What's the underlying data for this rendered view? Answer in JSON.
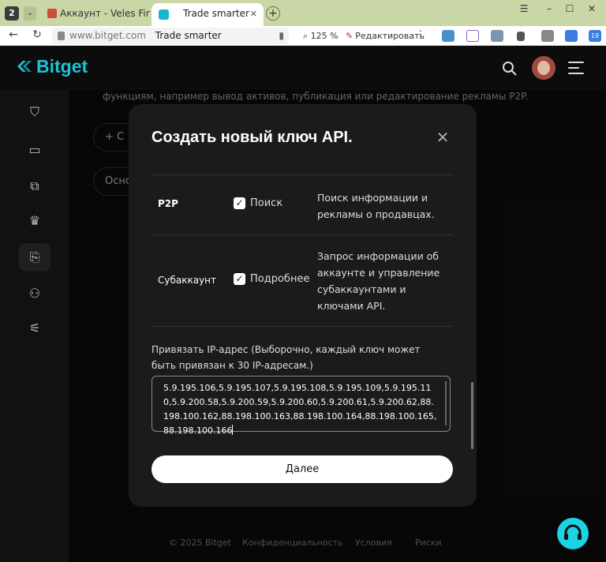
{
  "browser": {
    "tab_count": "2",
    "tabs": [
      {
        "label": "Аккаунт - Veles Finance"
      },
      {
        "label": "Trade smarter"
      }
    ],
    "url_host": "www.bitget.com",
    "url_title": "Trade smarter",
    "zoom": "125 %",
    "edit_label": "Редактировать",
    "ext_badge": "19"
  },
  "header": {
    "logo": "Bitget"
  },
  "background": {
    "notice": "функциям, например вывод активов, публикация или редактирование рекламы P2P.",
    "btn1": "+ С",
    "btn2": "Осно"
  },
  "modal": {
    "title": "Создать новый ключ API.",
    "permissions": [
      {
        "category": "P2P",
        "checkbox": "Поиск",
        "description": "Поиск информации и рекламы о продавцах."
      },
      {
        "category": "Субаккаунт",
        "checkbox": "Подробнее",
        "description": "Запрос информации об аккаунте и управление субаккаунтами и ключами API."
      }
    ],
    "ip_label": "Привязать IP-адрес (Выборочно, каждый ключ может быть привязан к 30 IP-адресам.)",
    "ip_value": "5.9.195.106,5.9.195.107,5.9.195.108,5.9.195.109,5.9.195.110,5.9.200.58,5.9.200.59,5.9.200.60,5.9.200.61,5.9.200.62,88.198.100.162,88.198.100.163,88.198.100.164,88.198.100.165,88.198.100.166",
    "next_label": "Далее"
  },
  "footer": {
    "copyright": "© 2025 Bitget",
    "privacy": "Конфиденциальность",
    "terms": "Условия",
    "risks": "Риски"
  },
  "colors": {
    "accent": "#1bc3d3",
    "background": "#0c0c0c",
    "modal": "#1b1b1b"
  }
}
